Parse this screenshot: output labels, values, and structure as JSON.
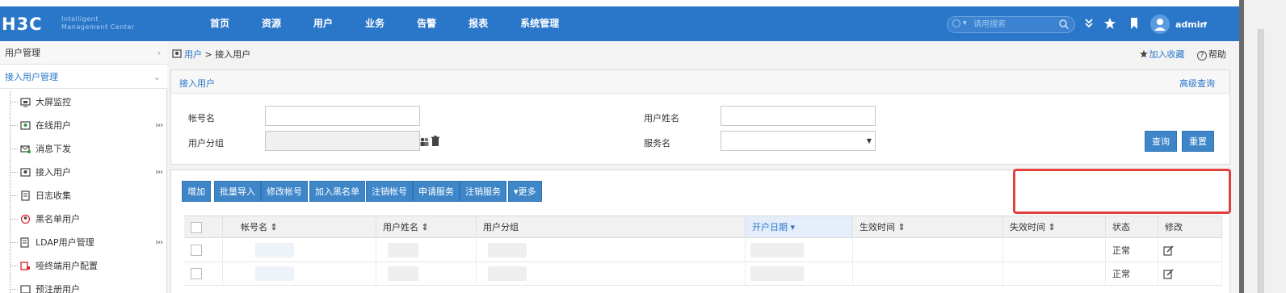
{
  "topbar": {
    "logo_main": "H3C",
    "logo_sub_line1": "Intelligent",
    "logo_sub_line2": "Management Center",
    "nav": [
      "首页",
      "资源",
      "用户",
      "业务",
      "告警",
      "报表",
      "系统管理"
    ],
    "search_placeholder": "请用搜索",
    "user": "admin",
    "icons": [
      "double-chevron-down-icon",
      "star-icon",
      "bookmark-icon",
      "avatar-icon"
    ]
  },
  "sidebar": {
    "section1": "用户管理",
    "section2": "接入用户管理",
    "items": [
      {
        "label": "大屏监控",
        "icon": "monitor-icon",
        "more": ""
      },
      {
        "label": "在线用户",
        "icon": "online-user-icon",
        "more": "›››"
      },
      {
        "label": "消息下发",
        "icon": "message-icon",
        "more": ""
      },
      {
        "label": "接入用户",
        "icon": "access-user-icon",
        "more": "›››"
      },
      {
        "label": "日志收集",
        "icon": "log-icon",
        "more": ""
      },
      {
        "label": "黑名单用户",
        "icon": "blacklist-icon",
        "more": ""
      },
      {
        "label": "LDAP用户管理",
        "icon": "ldap-icon",
        "more": "›››"
      },
      {
        "label": "哑终端用户配置",
        "icon": "dumb-terminal-icon",
        "more": ""
      },
      {
        "label": "预注册用户",
        "icon": "preregister-icon",
        "more": ""
      }
    ]
  },
  "breadcrumb": {
    "link": "用户",
    "sep": " > ",
    "current": "接入用户"
  },
  "top_actions": {
    "favorite": "加入收藏",
    "help": "帮助"
  },
  "query_panel": {
    "title": "接入用户",
    "advanced": "高级查询",
    "fields": {
      "account_label": "帐号名",
      "account_value": "",
      "group_label": "用户分组",
      "group_value": "",
      "username_label": "用户姓名",
      "username_value": "",
      "service_label": "服务名",
      "service_value": ""
    },
    "query_btn": "查询",
    "reset_btn": "重置"
  },
  "toolbar": [
    "增加",
    "批量导入",
    "修改帐号",
    "加入黑名单",
    "注销帐号",
    "申请服务",
    "注销服务",
    "▾更多"
  ],
  "table": {
    "headers": [
      "",
      "帐号名 ⇕",
      "用户姓名 ⇕",
      "用户分组",
      "开户日期 ▾",
      "生效时间 ⇕",
      "失效时间 ⇕",
      "状态",
      "修改"
    ],
    "rows": [
      {
        "status": "正常"
      },
      {
        "status": "正常"
      }
    ]
  },
  "colors": {
    "brand": "#2a76c8",
    "button": "#3f86c8",
    "highlight_box": "#e0413a"
  }
}
